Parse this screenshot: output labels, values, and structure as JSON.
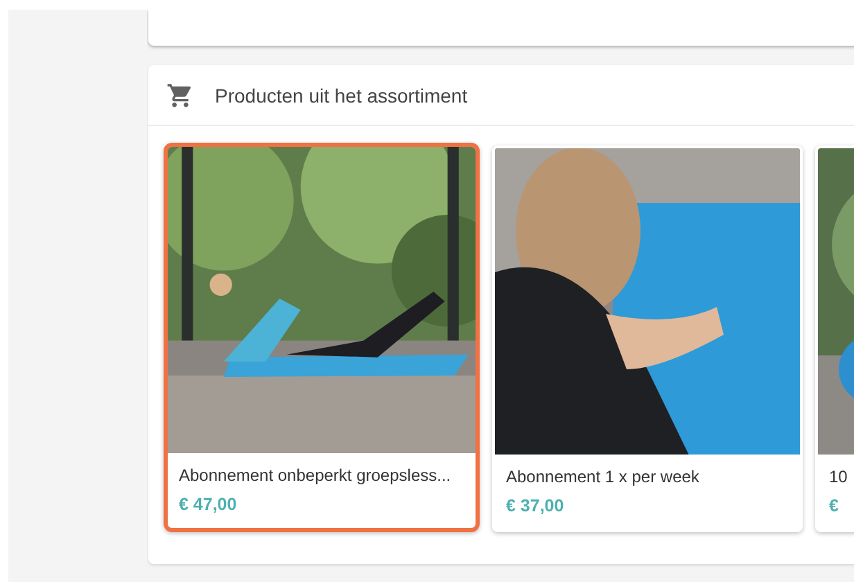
{
  "section": {
    "title": "Producten uit het assortiment"
  },
  "products": [
    {
      "name": "Abonnement onbeperkt groepsless...",
      "price": "€ 47,00",
      "selected": true
    },
    {
      "name": "Abonnement 1 x per week",
      "price": "€ 37,00",
      "selected": false
    },
    {
      "name": "10",
      "price": "€",
      "selected": false
    }
  ]
}
